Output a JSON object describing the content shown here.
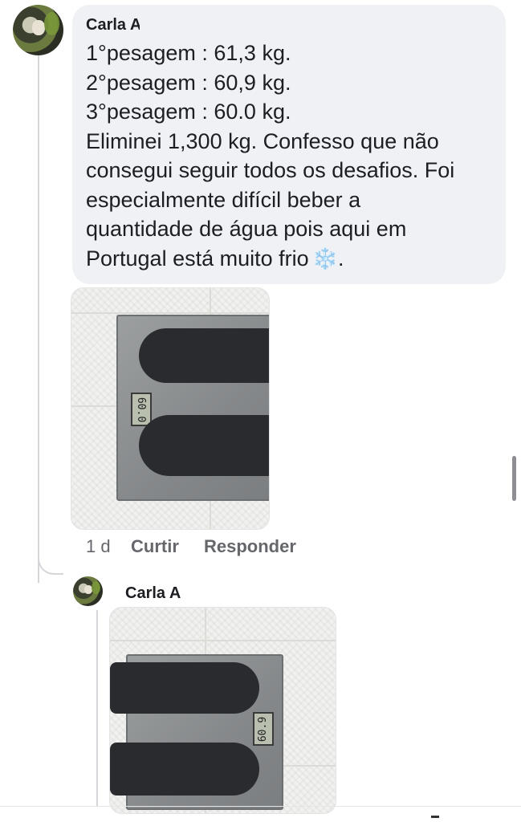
{
  "comment": {
    "author": "Carla A",
    "lines": [
      "1°pesagem : 61,3 kg.",
      "2°pesagem : 60,9 kg.",
      "3°pesagem : 60.0 kg.",
      "Eliminei 1,300 kg. Confesso que não",
      "consegui seguir todos os desafios. Foi",
      "especialmente difícil beber a",
      "quantidade de água pois aqui em",
      "Portugal está muito frio"
    ],
    "end_emoji": "❄️",
    "end_punct": ".",
    "photo_reading": "60.0",
    "actions": {
      "time": "1 d",
      "like": "Curtir",
      "reply": "Responder"
    }
  },
  "reply": {
    "author": "Carla A",
    "photo_reading": "60.9"
  }
}
